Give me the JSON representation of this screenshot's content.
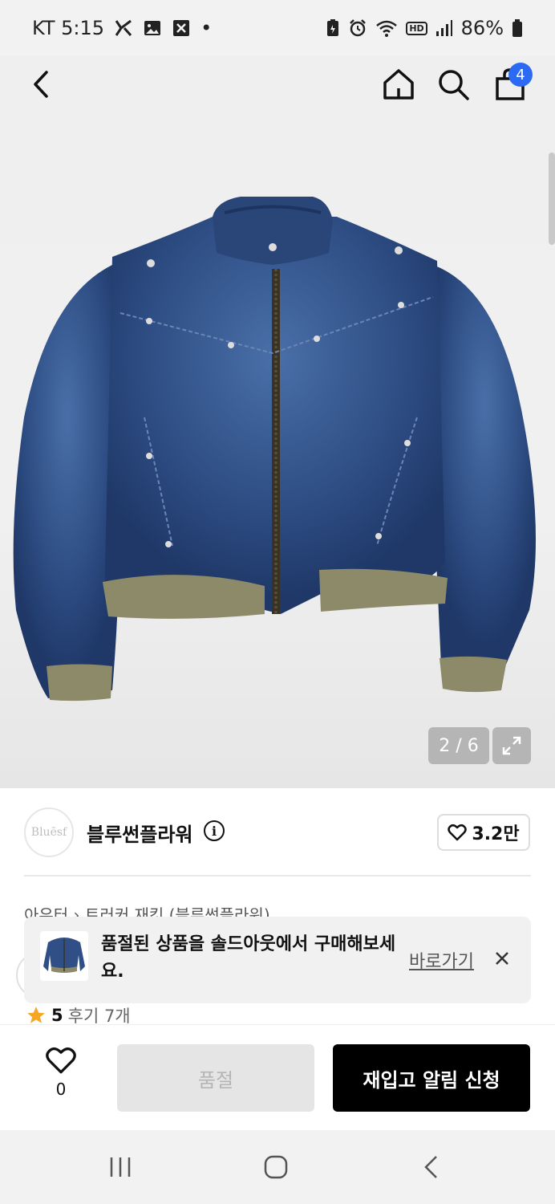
{
  "status_bar": {
    "carrier_time": "KT 5:15",
    "battery": "86%",
    "dot": "•",
    "icons_left": [
      "vpn-k-icon",
      "gallery-icon",
      "x-box-icon"
    ],
    "icons_right": [
      "battery-saver-icon",
      "alarm-icon",
      "wifi-icon",
      "hd-icon",
      "signal-icon",
      "battery-icon"
    ],
    "hd_label": "HD"
  },
  "nav": {
    "cart_count": "4",
    "icons": [
      "back-arrow-icon",
      "home-icon",
      "search-icon",
      "shopping-bag-icon"
    ]
  },
  "gallery": {
    "pager": "2 / 6",
    "image_description": "navy washed denim jacket with khaki ribbed cuffs and hem",
    "colors": {
      "denim": "#2d4f86",
      "rib": "#8c8a68"
    }
  },
  "brand": {
    "logo_text": "Bluēsf",
    "name": "블루썬플라워",
    "info_symbol": "i",
    "likes": "3.2만"
  },
  "product": {
    "breadcrumb": "아우터  ›  트러커 재킷 (블루썬플라워)",
    "rating": "5",
    "reviews": "후기 7개"
  },
  "toast": {
    "message": "품절된 상품을 솔드아웃에서 구매해보세요.",
    "link": "바로가기"
  },
  "actions": {
    "wish_count": "0",
    "soldout_label": "품절",
    "notify_label": "재입고 알림 신청",
    "accent": "#2b6bf3"
  },
  "system_nav": {
    "icons": [
      "recent-apps-icon",
      "home-circle-icon",
      "back-icon"
    ]
  }
}
